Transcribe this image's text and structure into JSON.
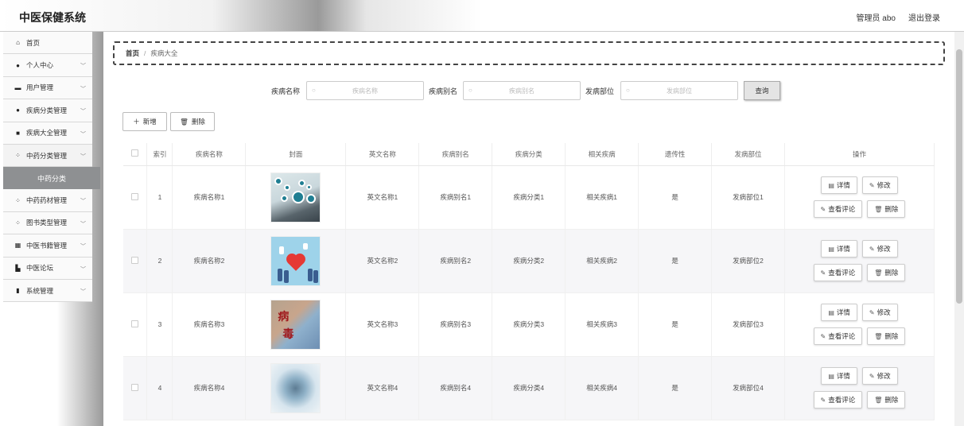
{
  "header": {
    "app_title": "中医保健系统",
    "user_label": "管理员 abo",
    "logout_label": "退出登录"
  },
  "sidebar": {
    "items": [
      {
        "label": "首页",
        "icon": "home-icon",
        "glyph": "⌂",
        "chevron": false
      },
      {
        "label": "个人中心",
        "icon": "user-icon",
        "glyph": "●",
        "chevron": true
      },
      {
        "label": "用户管理",
        "icon": "card-icon",
        "glyph": "▬",
        "chevron": true
      },
      {
        "label": "疾病分类管理",
        "icon": "user-icon",
        "glyph": "●",
        "chevron": true
      },
      {
        "label": "疾病大全管理",
        "icon": "clipboard-icon",
        "glyph": "■",
        "chevron": true
      },
      {
        "label": "中药分类管理",
        "icon": "grid-icon",
        "glyph": "⁘",
        "chevron": true,
        "expanded": true
      }
    ],
    "submenu": {
      "label": "中药分类"
    },
    "items_after": [
      {
        "label": "中药药材管理",
        "icon": "grid-icon",
        "glyph": "⁘",
        "chevron": true
      },
      {
        "label": "图书类型管理",
        "icon": "grid-icon",
        "glyph": "⁘",
        "chevron": true
      },
      {
        "label": "中医书籍管理",
        "icon": "table-icon",
        "glyph": "▦",
        "chevron": true
      },
      {
        "label": "中医论坛",
        "icon": "book-icon",
        "glyph": "▙",
        "chevron": true
      },
      {
        "label": "系统管理",
        "icon": "bar-chart-icon",
        "glyph": "▮",
        "chevron": true
      }
    ]
  },
  "breadcrumb": {
    "home": "首页",
    "separator": "/",
    "current": "疾病大全"
  },
  "search": {
    "fields": [
      {
        "label": "疾病名称",
        "placeholder": "疾病名称"
      },
      {
        "label": "疾病别名",
        "placeholder": "疾病别名"
      },
      {
        "label": "发病部位",
        "placeholder": "发病部位"
      }
    ],
    "query_label": "查询"
  },
  "toolbar": {
    "add_label": "新增",
    "delete_label": "删除"
  },
  "table": {
    "columns": [
      "索引",
      "疾病名称",
      "封面",
      "英文名称",
      "疾病别名",
      "疾病分类",
      "相关疾病",
      "遗传性",
      "发病部位",
      "操作"
    ],
    "rows": [
      {
        "index": "1",
        "name": "疾病名称1",
        "en": "英文名称1",
        "alias": "疾病别名1",
        "category": "疾病分类1",
        "related": "相关疾病1",
        "hereditary": "是",
        "site": "发病部位1"
      },
      {
        "index": "2",
        "name": "疾病名称2",
        "en": "英文名称2",
        "alias": "疾病别名2",
        "category": "疾病分类2",
        "related": "相关疾病2",
        "hereditary": "是",
        "site": "发病部位2"
      },
      {
        "index": "3",
        "name": "疾病名称3",
        "en": "英文名称3",
        "alias": "疾病别名3",
        "category": "疾病分类3",
        "related": "相关疾病3",
        "hereditary": "是",
        "site": "发病部位3"
      },
      {
        "index": "4",
        "name": "疾病名称4",
        "en": "英文名称4",
        "alias": "疾病别名4",
        "category": "疾病分类4",
        "related": "相关疾病4",
        "hereditary": "是",
        "site": "发病部位4"
      }
    ],
    "actions": {
      "detail": "详情",
      "edit": "修改",
      "comments": "查看评论",
      "delete": "删除"
    }
  }
}
